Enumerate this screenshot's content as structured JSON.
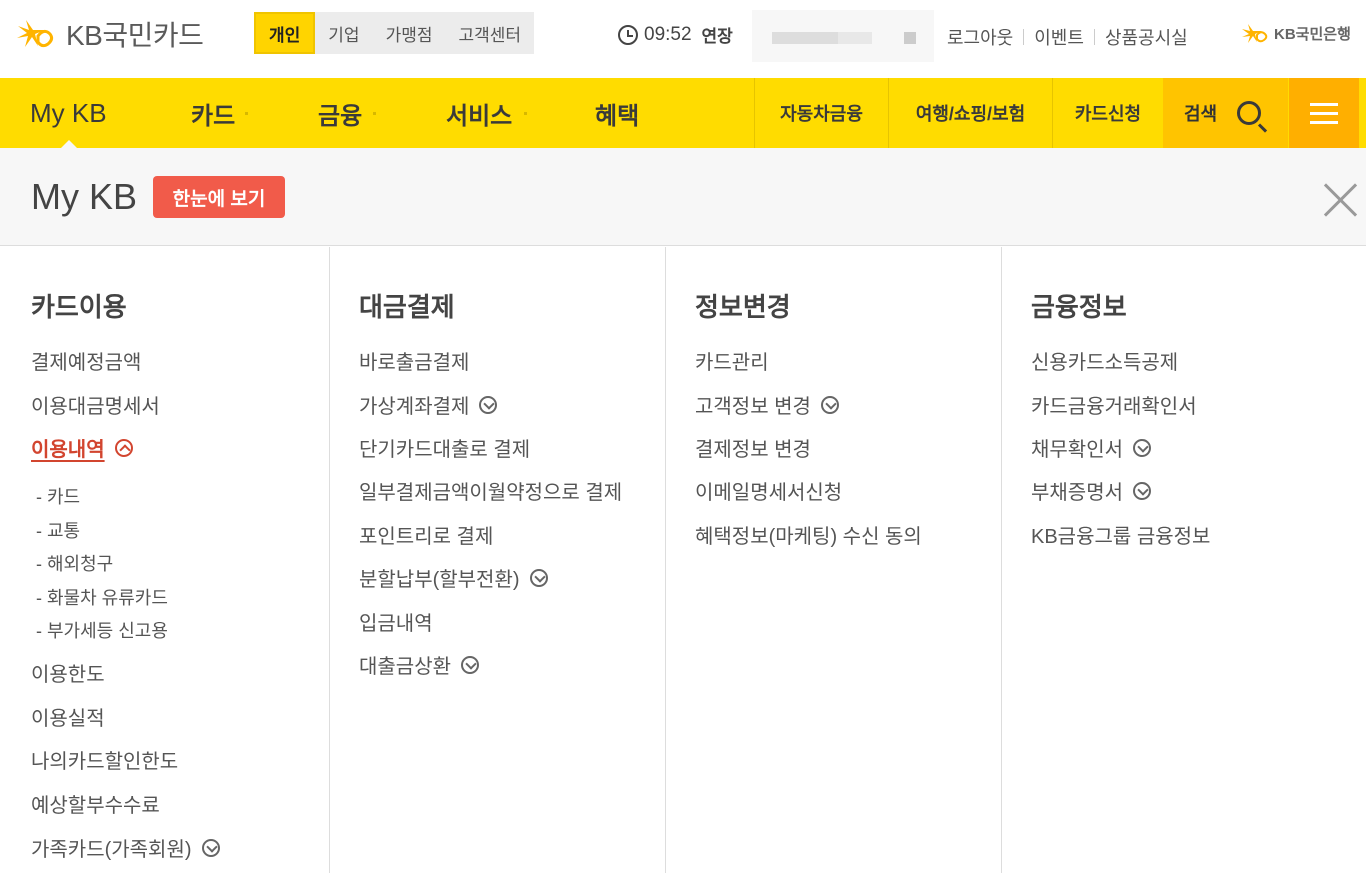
{
  "header": {
    "logo_text": "KB국민카드",
    "segment_tabs": [
      "개인",
      "기업",
      "가맹점",
      "고객센터"
    ],
    "active_segment": "개인",
    "session_time": "09:52",
    "extend_label": "연장",
    "util_links": [
      "로그아웃",
      "이벤트",
      "상품공시실"
    ],
    "bank_logo_text": "KB국민은행"
  },
  "gnb": {
    "items": [
      "My KB",
      "카드",
      "금융",
      "서비스",
      "혜택"
    ],
    "right_items": [
      "자동차금융",
      "여행/쇼핑/보험",
      "카드신청"
    ],
    "search_label": "검색",
    "colors": {
      "bar": "#ffdc00",
      "search": "#ffc400",
      "menu": "#ffaf00",
      "accent_red": "#f15b4a"
    }
  },
  "panel": {
    "title": "My KB",
    "overview_button": "한눈에 보기",
    "columns": [
      {
        "title": "카드이용",
        "items": [
          {
            "label": "결제예정금액"
          },
          {
            "label": "이용대금명세서"
          },
          {
            "label": "이용내역",
            "active": true,
            "sub": [
              "카드",
              "교통",
              "해외청구",
              "화물차 유류카드",
              "부가세등 신고용"
            ]
          },
          {
            "label": "이용한도"
          },
          {
            "label": "이용실적"
          },
          {
            "label": "나의카드할인한도"
          },
          {
            "label": "예상할부수수료"
          },
          {
            "label": "가족카드(가족회원)"
          }
        ]
      },
      {
        "title": "대금결제",
        "items": [
          {
            "label": "바로출금결제"
          },
          {
            "label": "가상계좌결제"
          },
          {
            "label": "단기카드대출로 결제"
          },
          {
            "label": "일부결제금액이월약정으로 결제"
          },
          {
            "label": "포인트리로 결제"
          },
          {
            "label": "분할납부(할부전환)"
          },
          {
            "label": "입금내역"
          },
          {
            "label": "대출금상환"
          }
        ]
      },
      {
        "title": "정보변경",
        "items": [
          {
            "label": "카드관리"
          },
          {
            "label": "고객정보 변경"
          },
          {
            "label": "결제정보 변경"
          },
          {
            "label": "이메일명세서신청"
          },
          {
            "label": "혜택정보(마케팅) 수신 동의"
          }
        ]
      },
      {
        "title": "금융정보",
        "items": [
          {
            "label": "신용카드소득공제"
          },
          {
            "label": "카드금융거래확인서"
          },
          {
            "label": "채무확인서"
          },
          {
            "label": "부채증명서"
          },
          {
            "label": "KB금융그룹 금융정보"
          }
        ]
      }
    ]
  }
}
